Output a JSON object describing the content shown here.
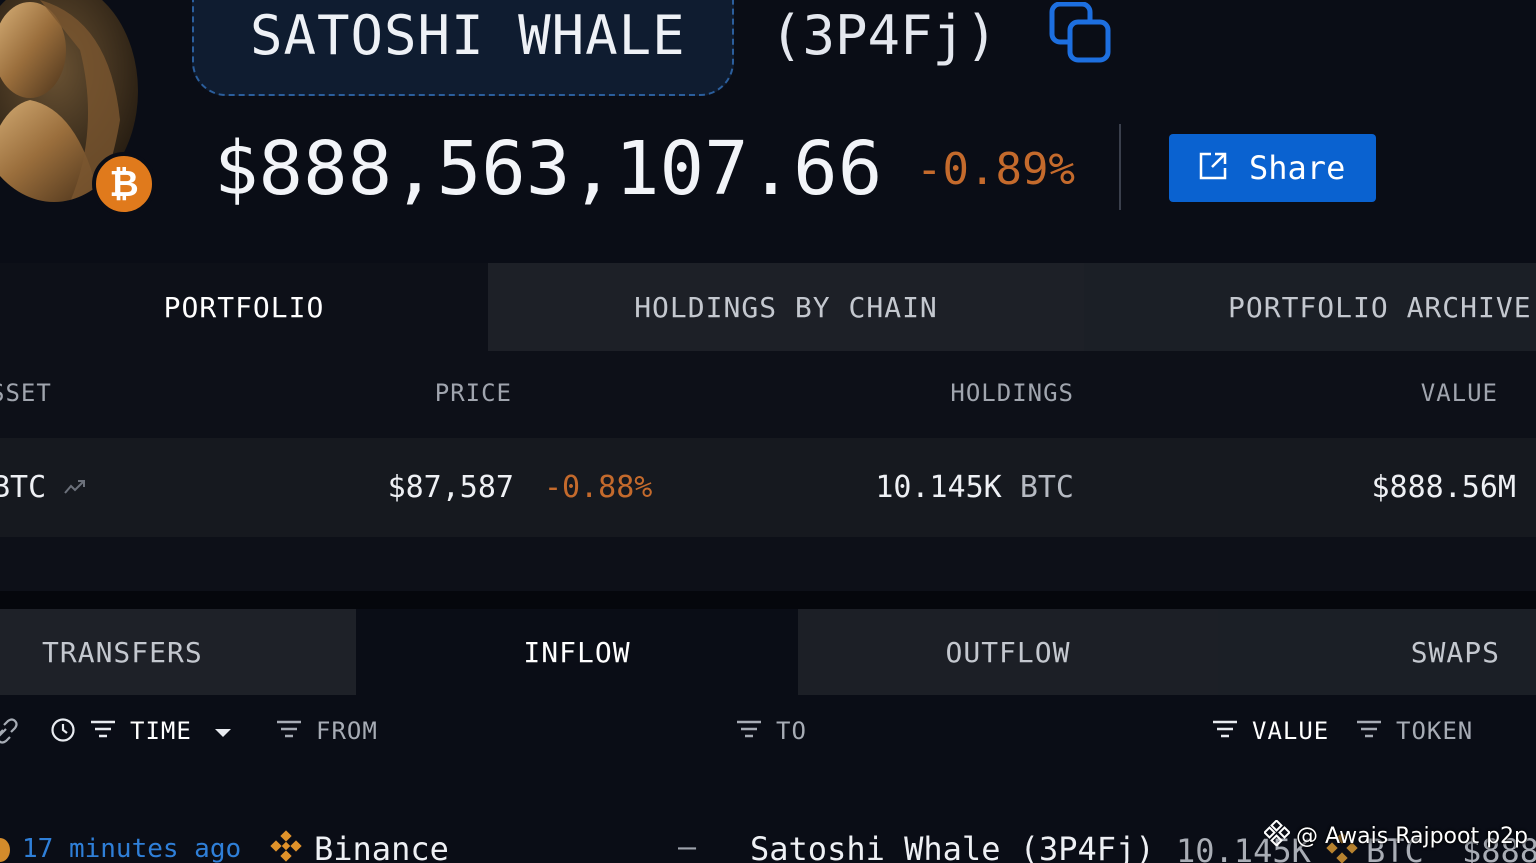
{
  "header": {
    "entity_name": "SATOSHI WHALE",
    "entity_address": "(3P4Fj)",
    "balance": "$888,563,107.66",
    "balance_change": "-0.89%",
    "share_label": "Share",
    "badge_glyph": "₿"
  },
  "portfolio_tabs": [
    "PORTFOLIO",
    "HOLDINGS BY CHAIN",
    "PORTFOLIO ARCHIVE"
  ],
  "portfolio_table": {
    "columns": {
      "asset": "SSET",
      "price": "PRICE",
      "holdings": "HOLDINGS",
      "value": "VALUE"
    },
    "rows": [
      {
        "asset": "BTC",
        "price": "$87,587",
        "price_change": "-0.88%",
        "holdings": "10.145K",
        "holdings_unit": "BTC",
        "value": "$888.56M"
      }
    ]
  },
  "flow_tabs": [
    "TRANSFERS",
    "INFLOW",
    "OUTFLOW",
    "SWAPS"
  ],
  "filters": {
    "time": "TIME",
    "from": "FROM",
    "to": "TO",
    "value": "VALUE",
    "token": "TOKEN"
  },
  "transaction": {
    "time": "17 minutes ago",
    "from": "Binance",
    "dash": "—",
    "to": "Satoshi Whale (3P4Fj)",
    "value": "10.145K",
    "token": "BTC",
    "usd": "$888"
  },
  "watermark": "@ Awais Rajpoot p2p",
  "colors": {
    "background": "#0a0d16",
    "accent_blue": "#0a62d0",
    "negative": "#c46a2c",
    "link_blue": "#2f7fd8",
    "bitcoin_orange": "#e07a1c",
    "binance_gold": "#e0922a"
  },
  "icons": [
    "copy-icon",
    "bitcoin-icon",
    "share-external-icon",
    "trend-icon",
    "link-icon",
    "clock-icon",
    "filter-icon",
    "caret-down-icon",
    "binance-icon"
  ]
}
